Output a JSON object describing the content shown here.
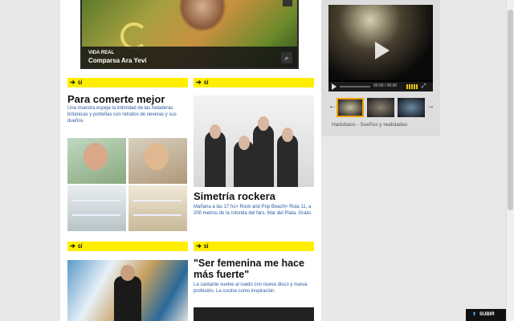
{
  "feature": {
    "kicker": "VIDA REAL",
    "title": "Comparsa Ara Yeví",
    "zoom_icon": "search-icon"
  },
  "articles": [
    {
      "tag": "SÍ",
      "title": "Para comerte mejor",
      "summary": "Una muestra espeja la intimidad de las heladeras británicas y porteñas con retratos de neveras y sus dueños"
    },
    {
      "tag": "SÍ",
      "title": "Simetría rockera",
      "summary": "Mañana a las 17 hs> Rock and Pop Beach> Ruta 11, a 200 metros de la rotonda del faro, Mar del Plata. Gratis."
    },
    {
      "tag": "SÍ",
      "title": ""
    },
    {
      "tag": "SÍ",
      "title": "\"Ser femenina me hace más fuerte\"",
      "summary": "La cantante vuelve al ruedo con nuevo disco y nueva profesión. La cocina como inspiración."
    }
  ],
  "video": {
    "time": "00:00 / 00:00",
    "caption": "Hadobaco - Sueños y realidades"
  },
  "subir": {
    "label": "SUBIR"
  },
  "colors": {
    "tag_yellow": "#ffee00",
    "link_blue": "#2a5aa0"
  }
}
